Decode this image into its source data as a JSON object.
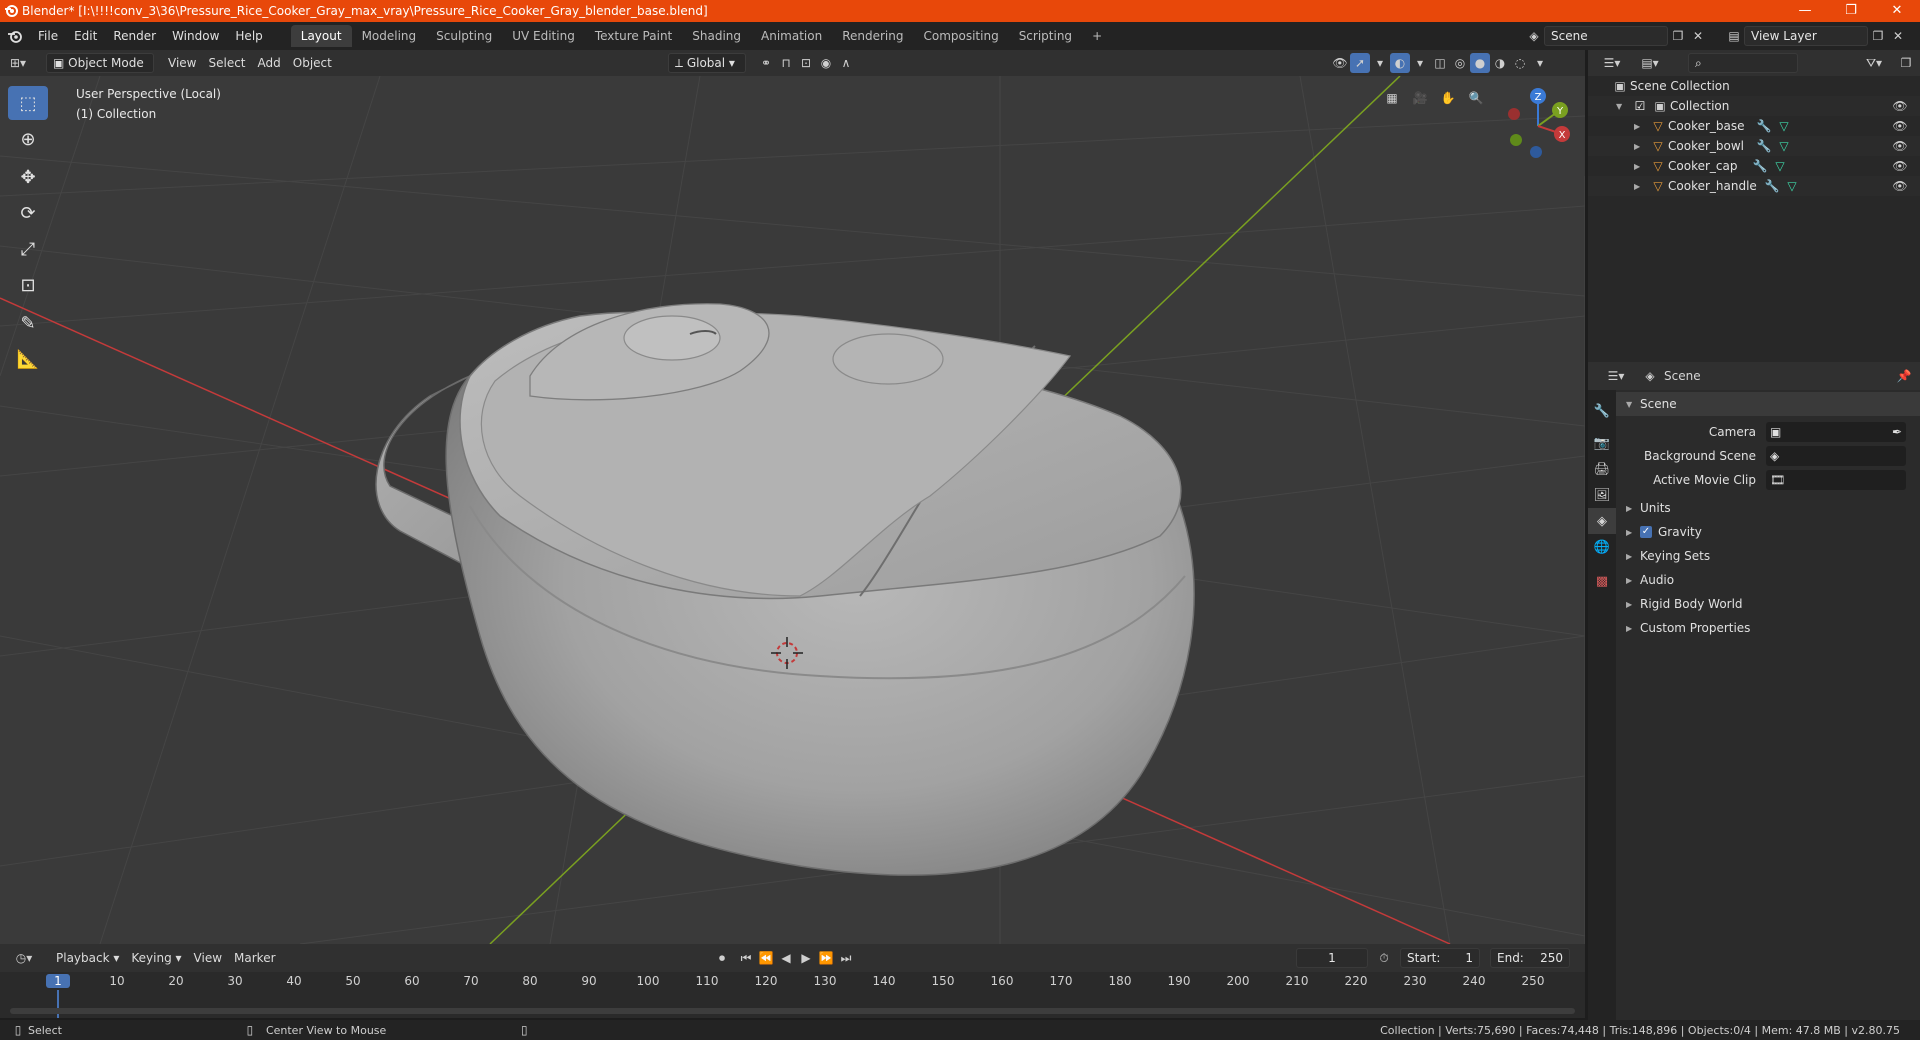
{
  "titlebar": {
    "title": "Blender* [I:\\!!!!conv_3\\36\\Pressure_Rice_Cooker_Gray_max_vray\\Pressure_Rice_Cooker_Gray_blender_base.blend]",
    "minimize": "—",
    "maximize": "❐",
    "close": "✕"
  },
  "menu": {
    "items": [
      "File",
      "Edit",
      "Render",
      "Window",
      "Help"
    ]
  },
  "workspaces": {
    "tabs": [
      "Layout",
      "Modeling",
      "Sculpting",
      "UV Editing",
      "Texture Paint",
      "Shading",
      "Animation",
      "Rendering",
      "Compositing",
      "Scripting"
    ],
    "add": "+"
  },
  "scene_selector": {
    "value": "Scene"
  },
  "view_layer_selector": {
    "value": "View Layer"
  },
  "viewport_header": {
    "mode": "Object Mode",
    "menus": [
      "View",
      "Select",
      "Add",
      "Object"
    ],
    "transform_orientation": "Global"
  },
  "viewport": {
    "perspective_label": "User Perspective (Local)",
    "collection_label": "(1) Collection",
    "gizmo": {
      "x": "X",
      "y": "Y",
      "z": "Z"
    }
  },
  "outliner": {
    "root": "Scene Collection",
    "collection": "Collection",
    "objects": [
      "Cooker_base",
      "Cooker_bowl",
      "Cooker_cap",
      "Cooker_handle"
    ]
  },
  "properties": {
    "header_title": "Scene",
    "panel_title": "Scene",
    "fields": [
      {
        "label": "Camera"
      },
      {
        "label": "Background Scene"
      },
      {
        "label": "Active Movie Clip"
      }
    ],
    "sections": [
      "Units",
      "Gravity",
      "Keying Sets",
      "Audio",
      "Rigid Body World",
      "Custom Properties"
    ]
  },
  "timeline": {
    "menus": [
      "Playback",
      "Keying",
      "View",
      "Marker"
    ],
    "current_frame": "1",
    "start_label": "Start:",
    "start": "1",
    "end_label": "End:",
    "end": "250",
    "ruler": [
      "1",
      "10",
      "20",
      "30",
      "40",
      "50",
      "60",
      "70",
      "80",
      "90",
      "100",
      "110",
      "120",
      "130",
      "140",
      "150",
      "160",
      "170",
      "180",
      "190",
      "200",
      "210",
      "220",
      "230",
      "240",
      "250"
    ]
  },
  "statusbar": {
    "left_action": "Select",
    "middle_action": "Center View to Mouse",
    "stats": "Collection | Verts:75,690 | Faces:74,448 | Tris:148,896 | Objects:0/4 | Mem: 47.8 MB | v2.80.75"
  },
  "colors": {
    "titlebar": "#e8480a",
    "accent": "#4772b3",
    "x_axis": "#c43a3a",
    "y_axis": "#7aa020",
    "z_axis": "#3a7ad6"
  }
}
